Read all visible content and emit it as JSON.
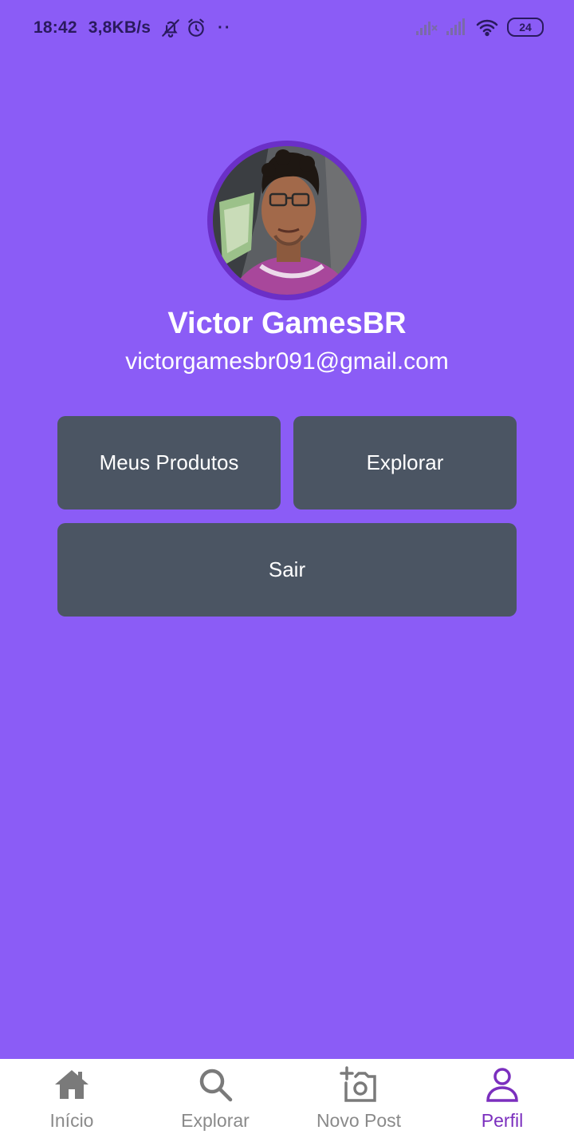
{
  "status_bar": {
    "time": "18:42",
    "speed": "3,8KB/s",
    "battery": "24",
    "icons": [
      "bell-off-icon",
      "alarm-icon",
      "signal-icon",
      "signal-icon",
      "wifi-icon",
      "battery-icon"
    ]
  },
  "profile": {
    "name": "Victor GamesBR",
    "email": "victorgamesbr091@gmail.com"
  },
  "buttons": {
    "my_products": "Meus Produtos",
    "explore": "Explorar",
    "logout": "Sair"
  },
  "bottom_nav": {
    "items": [
      {
        "label": "Início",
        "icon": "home-icon"
      },
      {
        "label": "Explorar",
        "icon": "search-icon"
      },
      {
        "label": "Novo Post",
        "icon": "add-photo-icon"
      },
      {
        "label": "Perfil",
        "icon": "user-icon",
        "active": true
      }
    ]
  },
  "colors": {
    "background": "#8B5CF6",
    "button": "#4B5563",
    "avatar_ring": "#6B2FC7",
    "nav_active": "#7B2FBE",
    "nav_inactive": "#8a8a8a"
  }
}
